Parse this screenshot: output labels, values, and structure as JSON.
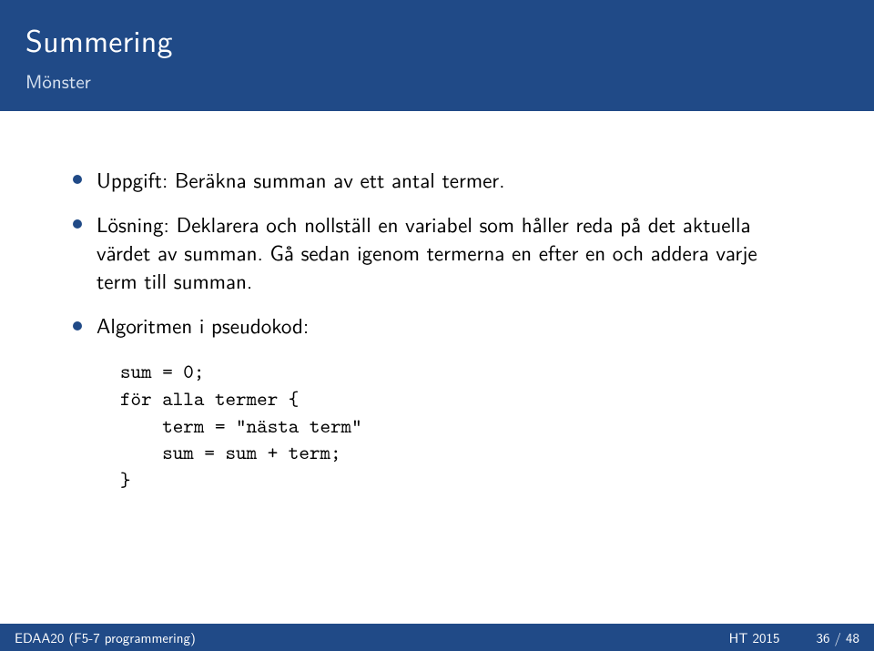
{
  "header": {
    "title": "Summering",
    "subtitle": "Mönster"
  },
  "bullets": [
    "Uppgift: Beräkna summan av ett antal termer.",
    "Lösning: Deklarera och nollställ en variabel som håller reda på det aktuella värdet av summan. Gå sedan igenom termerna en efter en och addera varje term till summan.",
    "Algoritmen i pseudokod:"
  ],
  "code": "sum = 0;\nför alla termer {\n    term = \"nästa term\"\n    sum = sum + term;\n}",
  "footer": {
    "left": "EDAA20 (F5-7 programmering)",
    "right_term": "HT 2015",
    "right_page": "36 / 48"
  }
}
